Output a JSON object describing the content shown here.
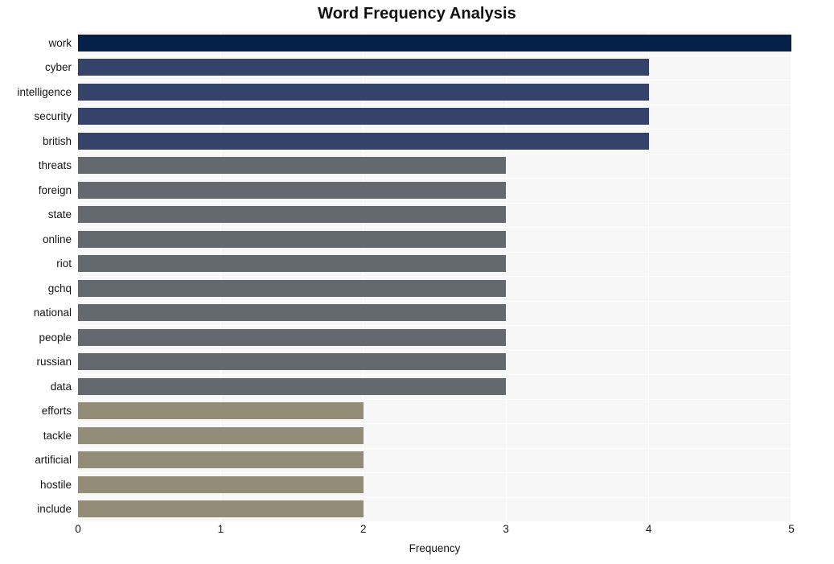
{
  "chart_data": {
    "type": "bar",
    "orientation": "horizontal",
    "title": "Word Frequency Analysis",
    "xlabel": "Frequency",
    "ylabel": "",
    "categories": [
      "work",
      "cyber",
      "intelligence",
      "security",
      "british",
      "threats",
      "foreign",
      "state",
      "online",
      "riot",
      "gchq",
      "national",
      "people",
      "russian",
      "data",
      "efforts",
      "tackle",
      "artificial",
      "hostile",
      "include"
    ],
    "values": [
      5,
      4,
      4,
      4,
      4,
      3,
      3,
      3,
      3,
      3,
      3,
      3,
      3,
      3,
      3,
      2,
      2,
      2,
      2,
      2
    ],
    "bar_colors": [
      "#052049",
      "#35436b",
      "#35436b",
      "#35436b",
      "#35436b",
      "#64686f",
      "#64686f",
      "#64686f",
      "#64686f",
      "#64686f",
      "#64686f",
      "#64686f",
      "#64686f",
      "#64686f",
      "#64686f",
      "#938d77",
      "#938d77",
      "#938d77",
      "#938d77",
      "#938d77"
    ],
    "xticks": [
      0,
      1,
      2,
      3,
      4,
      5
    ],
    "xtick_labels": [
      "0",
      "1",
      "2",
      "3",
      "4",
      "5"
    ],
    "xlim": [
      0,
      5
    ],
    "grid": true,
    "grid_axis": "both",
    "legend": null,
    "plot_background": "#f7f7f7",
    "figure_background": "#ffffff",
    "gridline_color": "#ffffff"
  }
}
